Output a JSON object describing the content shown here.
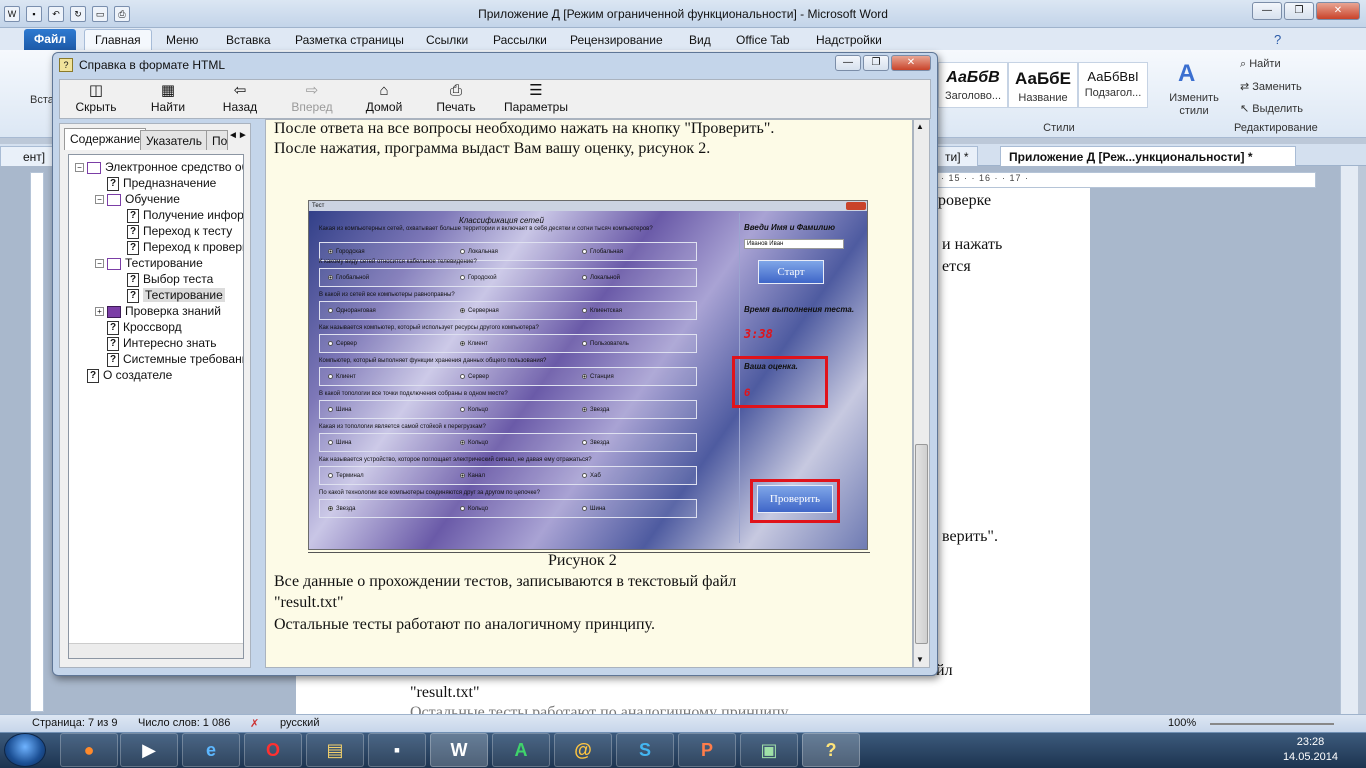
{
  "word": {
    "title": "Приложение Д [Режим ограниченной функциональности]  -  Microsoft Word",
    "file_tab": "Файл",
    "tabs": [
      "Главная",
      "Меню",
      "Вставка",
      "Разметка страницы",
      "Ссылки",
      "Рассылки",
      "Рецензирование",
      "Вид",
      "Office Tab",
      "Надстройки"
    ],
    "ribbon": {
      "paste_label": "Вста",
      "styles": [
        {
          "sample": "АаБбВ",
          "name": "Заголово..."
        },
        {
          "sample": "АаБбЕ",
          "name": "Название"
        },
        {
          "sample": "АаБбВвІ",
          "name": "Подзагол..."
        }
      ],
      "change_styles": "Изменить стили",
      "styles_group": "Стили",
      "find": "Найти",
      "replace": "Заменить",
      "select": "Выделить",
      "edit_group": "Редактирование"
    },
    "doc_tabs": {
      "left_partial": "ент]",
      "mid_partial": "ти] *",
      "active": "Приложение Д [Реж...ункциональности] *"
    },
    "ruler": "· 15 · · 16 · · 17 ·",
    "page_texts": {
      "line1": "роверке",
      "line2": "и нажать",
      "line3": "ется",
      "line4": "верить\".",
      "line5": "йл",
      "line6": "\"result.txt\"",
      "line7": "Остальные тесты работают по аналогичному принципу."
    },
    "status": {
      "page": "Страница: 7 из 9",
      "words": "Число слов: 1 086",
      "lang": "русский",
      "zoom": "100%"
    }
  },
  "taskbar": {
    "time": "23:28",
    "date": "14.05.2014"
  },
  "help": {
    "title": "Справка в формате HTML",
    "toolbar": {
      "hide": "Скрыть",
      "find": "Найти",
      "back": "Назад",
      "forward": "Вперед",
      "home": "Домой",
      "print": "Печать",
      "options": "Параметры"
    },
    "left_tabs": [
      "Содержание",
      "Указатель",
      "По"
    ],
    "toc": [
      {
        "label": "Электронное средство обу",
        "level": 0,
        "type": "book-open",
        "expander": "−"
      },
      {
        "label": "Предназначение",
        "level": 1,
        "type": "page"
      },
      {
        "label": "Обучение",
        "level": 1,
        "type": "book-open",
        "expander": "−"
      },
      {
        "label": "Получение информ",
        "level": 2,
        "type": "page"
      },
      {
        "label": "Переход к тесту",
        "level": 2,
        "type": "page"
      },
      {
        "label": "Переход к проверк",
        "level": 2,
        "type": "page"
      },
      {
        "label": "Тестирование",
        "level": 1,
        "type": "book-open",
        "expander": "−"
      },
      {
        "label": "Выбор теста",
        "level": 2,
        "type": "page"
      },
      {
        "label": "Тестирование",
        "level": 2,
        "type": "page",
        "selected": true
      },
      {
        "label": "Проверка знаний",
        "level": 1,
        "type": "book",
        "expander": "+"
      },
      {
        "label": "Кроссворд",
        "level": 1,
        "type": "page"
      },
      {
        "label": "Интересно знать",
        "level": 1,
        "type": "page"
      },
      {
        "label": "Системные требовани:",
        "level": 1,
        "type": "page"
      },
      {
        "label": "О создателе",
        "level": 0,
        "type": "page"
      }
    ],
    "content": {
      "top1": "После ответа на все вопросы необходимо нажать на кнопку \"Проверить\".",
      "top2": "После нажатия, программа выдаст Вам вашу оценку, рисунок 2.",
      "caption": "Рисунок 2",
      "p1": "Все данные о прохождении тестов, записываются в текстовый файл",
      "p2": "\"result.txt\"",
      "p3": "Остальные тесты работают по аналогичному принципу."
    }
  },
  "figure": {
    "window_title": "Тест",
    "heading": "Классификация сетей",
    "questions": [
      {
        "q": "Какая из компьютерных сетей, охватывает больше территории и включает в себя десятки и сотни тысяч компьютеров?",
        "opts": [
          "Городская",
          "Локальная",
          "Глобальная"
        ],
        "sel": 0
      },
      {
        "q": "К какому виду сетей относится кабельное телевидение?",
        "opts": [
          "Глобальной",
          "Городской",
          "Локальной"
        ],
        "sel": 0
      },
      {
        "q": "В какой из сетей все компьютеры равноправны?",
        "opts": [
          "Одноранговая",
          "Серверная",
          "Клиентская"
        ],
        "sel": 1
      },
      {
        "q": "Как называется компьютер, который использует ресурсы другого компьютера?",
        "opts": [
          "Сервер",
          "Клиент",
          "Пользователь"
        ],
        "sel": 1
      },
      {
        "q": "Компьютер, который выполняет функции хранения данных общего пользования?",
        "opts": [
          "Клиент",
          "Сервер",
          "Станция"
        ],
        "sel": 2
      },
      {
        "q": "В какой топологии все точки подключения собраны в одном месте?",
        "opts": [
          "Шина",
          "Кольцо",
          "Звезда"
        ],
        "sel": 2
      },
      {
        "q": "Какая из топологии является самой стойкой к перегрузкам?",
        "opts": [
          "Шина",
          "Кольцо",
          "Звезда"
        ],
        "sel": 1
      },
      {
        "q": "Как называется устройство, которое поглощает электрический сигнал, не давая ему отражаться?",
        "opts": [
          "Терминал",
          "Канал",
          "Хаб"
        ],
        "sel": 1
      },
      {
        "q": "По какой технологии все компьютеры соединяются друг за другом по цепочке?",
        "opts": [
          "Звезда",
          "Кольцо",
          "Шина"
        ],
        "sel": 0
      }
    ],
    "name_label": "Введи Имя и Фамилию",
    "name_value": "Иванов Иван",
    "start": "Старт",
    "time_label": "Время выполнения теста.",
    "time_value": "3:38",
    "grade_label": "Ваша оценка.",
    "grade_value": "6",
    "check": "Проверить"
  }
}
